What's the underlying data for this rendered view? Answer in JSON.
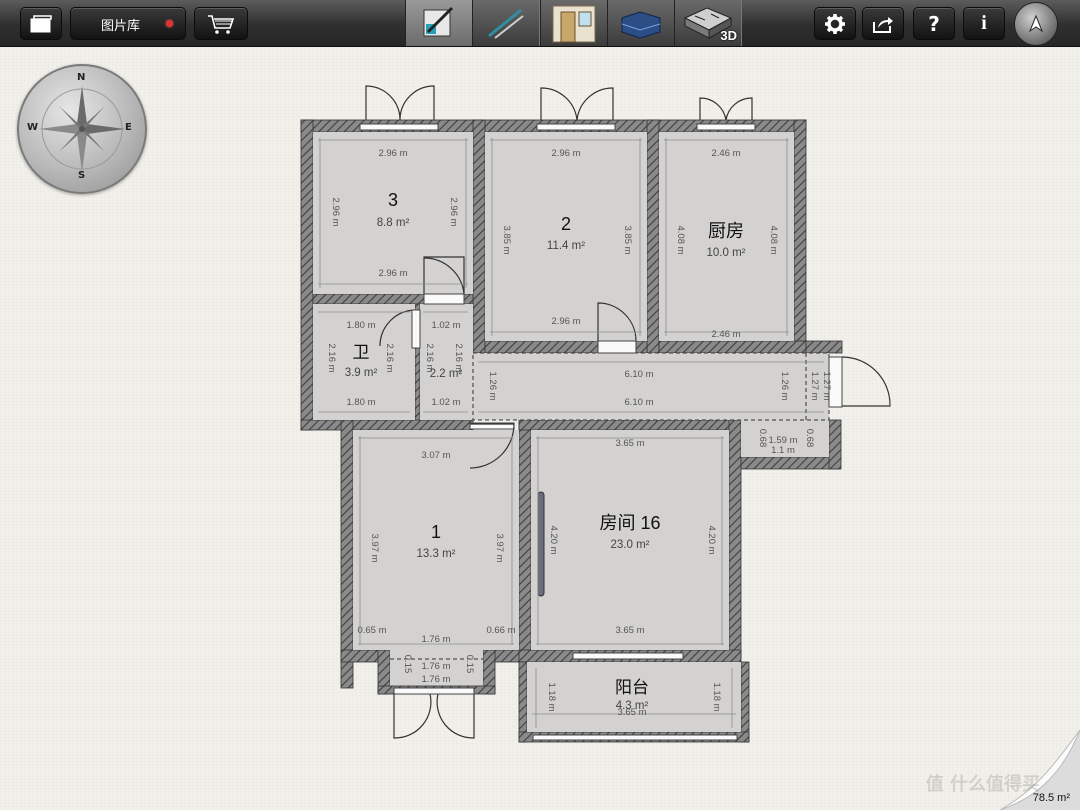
{
  "toolbar": {
    "gallery_label": "图片库",
    "mode_3d_label": "3D",
    "info_label": "i",
    "help_label": "?"
  },
  "compass": {
    "n": "N",
    "s": "S",
    "e": "E",
    "w": "W"
  },
  "rooms": {
    "r3": {
      "name": "3",
      "area": "8.8 m²",
      "top": "2.96 m",
      "bottom": "2.96 m",
      "left": "2.96 m",
      "right": "2.96 m"
    },
    "r2": {
      "name": "2",
      "area": "11.4 m²",
      "top": "2.96 m",
      "bottom": "2.96 m",
      "left": "3.85 m",
      "right": "3.85 m"
    },
    "kitchen": {
      "name": "厨房",
      "area": "10.0 m²",
      "top": "2.46 m",
      "bottom": "2.46 m",
      "left": "4.08 m",
      "right": "4.08 m"
    },
    "bath": {
      "name": "卫",
      "area": "3.9 m²",
      "top": "1.80 m",
      "bottom": "1.80 m",
      "left": "2.16 m",
      "right": "2.16 m"
    },
    "closet": {
      "area": "2.2 m²",
      "top": "1.02 m",
      "bottom": "1.02 m",
      "left": "2.16 m",
      "right": "2.16 m"
    },
    "hall": {
      "top": "6.10 m",
      "bottom": "6.10 m",
      "left": "1.26 m",
      "right": "1.26 m"
    },
    "hall_end": {
      "a": "1.27 m",
      "b": "1.27 m"
    },
    "small": {
      "top": "1.59 m",
      "bottom": "1.1 m",
      "left": "0.68",
      "right": "0.68"
    },
    "r1": {
      "name": "1",
      "area": "13.3 m²",
      "top": "3.07 m",
      "left": "3.97 m",
      "right": "3.97 m",
      "bl": "0.65 m",
      "bm": "1.76 m",
      "br": "0.66 m"
    },
    "r1_entry": {
      "a": "1.76 m",
      "b": "1.76 m",
      "l": "0.15",
      "r": "0.15"
    },
    "r16": {
      "name": "房间 16",
      "area": "23.0 m²",
      "top": "3.65 m",
      "bottom": "3.65 m",
      "left": "4.20 m",
      "right": "4.20 m"
    },
    "balcony": {
      "name": "阳台",
      "area": "4.3 m²",
      "bottom": "3.65 m",
      "left": "1.18 m",
      "right": "1.18 m"
    }
  },
  "total_area": "78.5 m²",
  "watermark": "值 什么值得买",
  "colors": {
    "wall": "#6d6d6d",
    "floor": "#d3d2d0",
    "paper": "#f2f0ea",
    "dot": "#e23333"
  }
}
